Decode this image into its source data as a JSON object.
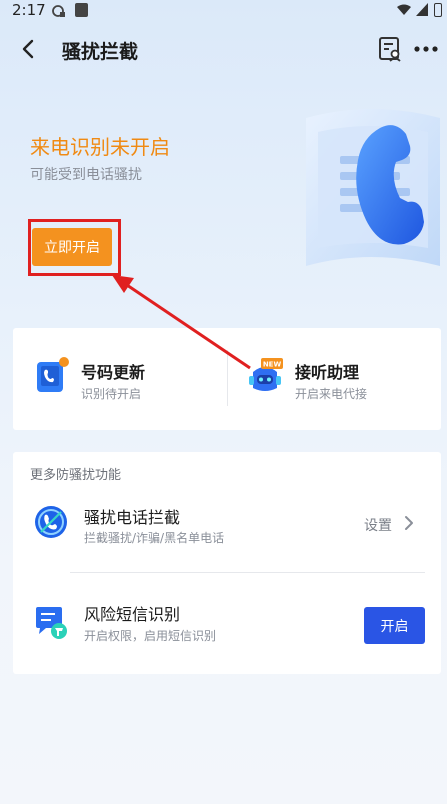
{
  "status_bar": {
    "time": "2:17"
  },
  "nav": {
    "title": "骚扰拦截"
  },
  "hero": {
    "title": "来电识别未开启",
    "subtitle": "可能受到电话骚扰",
    "button_label": "立即开启",
    "accent_color": "#f4921f"
  },
  "features": [
    {
      "name": "号码更新",
      "desc": "识别待开启",
      "icon": "phone-book-icon"
    },
    {
      "name": "接听助理",
      "desc": "开启来电代接",
      "icon": "robot-assistant-icon",
      "badge": "NEW"
    }
  ],
  "more": {
    "title": "更多防骚扰功能",
    "items": [
      {
        "name": "骚扰电话拦截",
        "desc": "拦截骚扰/诈骗/黑名单电话",
        "action": "设置",
        "icon": "call-block-icon"
      },
      {
        "name": "风险短信识别",
        "desc": "开启权限，启用短信识别",
        "action": "开启",
        "icon": "sms-shield-icon"
      }
    ]
  }
}
